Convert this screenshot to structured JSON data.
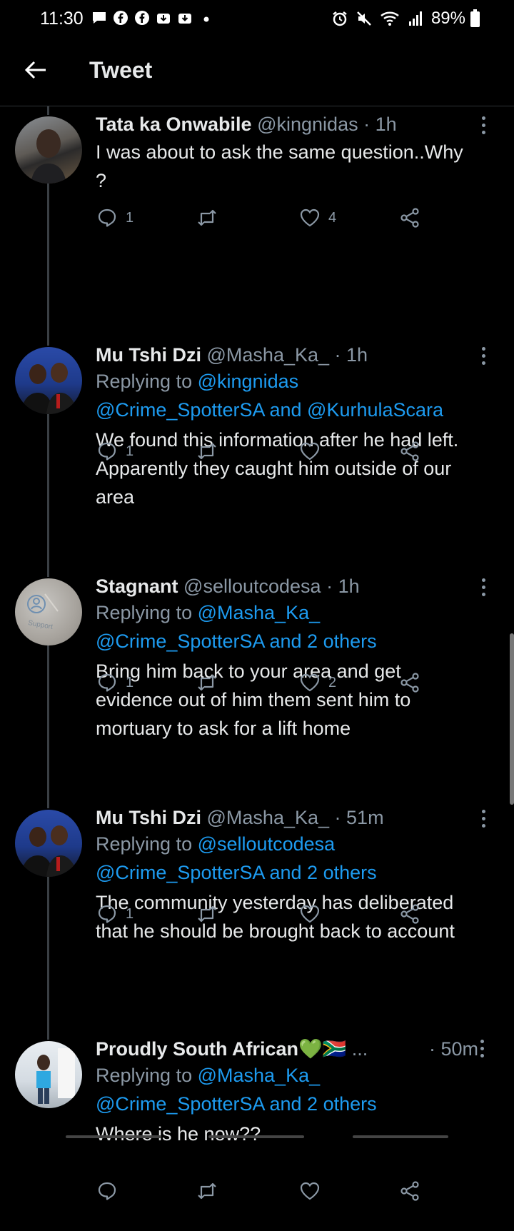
{
  "status_bar": {
    "time": "11:30",
    "battery": "89%",
    "left_icons": [
      "message-icon",
      "facebook-icon",
      "facebook-icon",
      "download-icon",
      "download-icon",
      "dot-icon"
    ],
    "right_icons": [
      "alarm-icon",
      "mute-icon",
      "wifi-icon",
      "signal-icon"
    ]
  },
  "header": {
    "title": "Tweet"
  },
  "tweets": [
    {
      "name": "Tata ka Onwabile",
      "handle": "@kingnidas",
      "time": "· 1h",
      "replying_label": "",
      "replying_handle": "",
      "replying_others": "",
      "text": "I was about to ask the same question..Why ?",
      "replies": "1",
      "retweets": "",
      "likes": "4"
    },
    {
      "name": "Mu Tshi Dzi",
      "handle": "@Masha_Ka_",
      "time": "· 1h",
      "replying_label": "Replying to",
      "replying_handle": "@kingnidas",
      "replying_others": "@Crime_SpotterSA and @KurhulaScara",
      "text": "We found this information after he had left. Apparently they caught him outside of our area",
      "replies": "1",
      "retweets": "",
      "likes": ""
    },
    {
      "name": "Stagnant",
      "handle": "@selloutcodesa",
      "time": "· 1h",
      "replying_label": "Replying to",
      "replying_handle": "@Masha_Ka_",
      "replying_others": "@Crime_SpotterSA and 2 others",
      "text": "Bring him back to your area and get evidence out of him them sent him to mortuary to ask for a lift home",
      "replies": "1",
      "retweets": "",
      "likes": "2",
      "avatar_label": "Support"
    },
    {
      "name": "Mu Tshi Dzi",
      "handle": "@Masha_Ka_",
      "time": "· 51m",
      "replying_label": "Replying to",
      "replying_handle": "@selloutcodesa",
      "replying_others": "@Crime_SpotterSA and 2 others",
      "text": "The community yesterday has deliberated that he should be brought back to account",
      "replies": "1",
      "retweets": "",
      "likes": ""
    },
    {
      "name": "Proudly South African💚🇿🇦",
      "handle": "...",
      "time": "· 50m",
      "replying_label": "Replying to",
      "replying_handle": "@Masha_Ka_",
      "replying_others": "@Crime_SpotterSA and 2 others",
      "text": "Where is he now??",
      "replies": "",
      "retweets": "",
      "likes": ""
    }
  ]
}
